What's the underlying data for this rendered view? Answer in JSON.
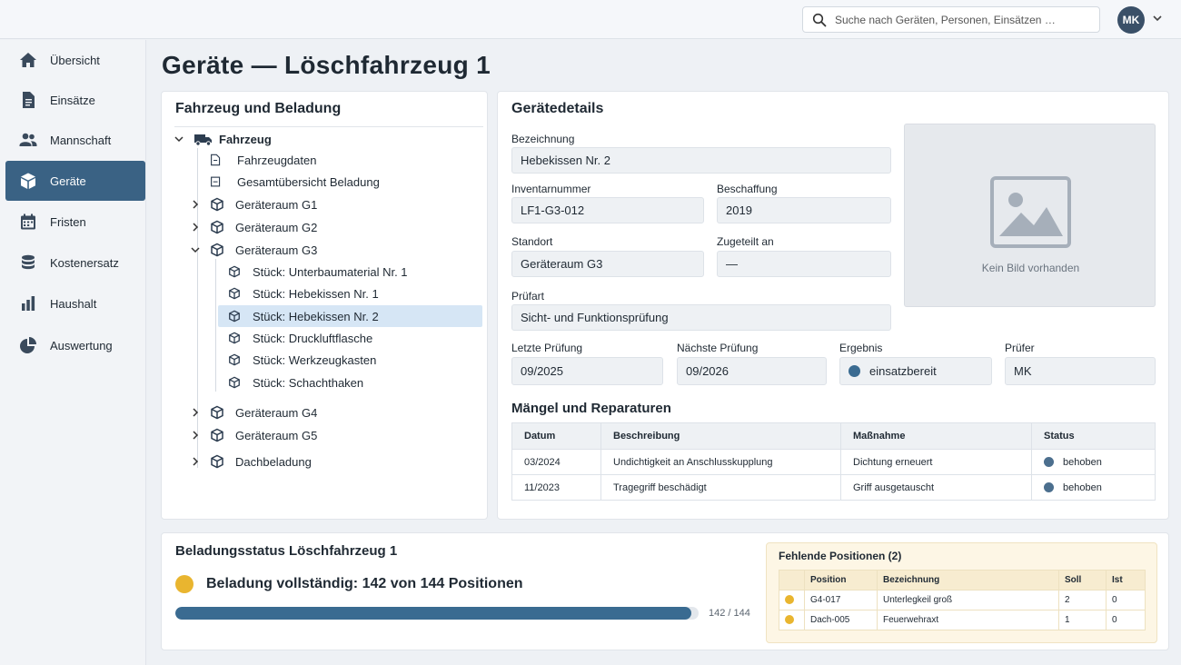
{
  "topbar": {
    "search_placeholder": "Suche nach Geräten, Personen, Einsätzen …",
    "user_initials": "MK"
  },
  "sidebar": {
    "items": [
      {
        "label": "Übersicht",
        "icon": "home-icon"
      },
      {
        "label": "Einsätze",
        "icon": "document-icon"
      },
      {
        "label": "Mannschaft",
        "icon": "people-icon"
      },
      {
        "label": "Geräte",
        "icon": "box-icon",
        "active": true
      },
      {
        "label": "Fristen",
        "icon": "calendar-icon"
      },
      {
        "label": "Kostenersatz",
        "icon": "coins-icon"
      },
      {
        "label": "Haushalt",
        "icon": "bar-chart-icon"
      },
      {
        "label": "Auswertung",
        "icon": "pie-chart-icon"
      }
    ]
  },
  "page": {
    "title": "Geräte — Löschfahrzeug 1"
  },
  "tree": {
    "title": "Fahrzeug und Beladung",
    "root": "Fahrzeug",
    "items": [
      "Fahrzeugdaten",
      "Gesamtübersicht Beladung",
      "Geräteraum G1",
      "Geräteraum G2",
      "Geräteraum G3",
      "Stück: Unterbaumaterial Nr. 1",
      "Stück: Hebekissen Nr. 1",
      "Stück: Hebekissen Nr. 2",
      "Stück: Druckluftflasche",
      "Stück: Werkzeugkasten",
      "Stück: Schachthaken",
      "Geräteraum G4",
      "Geräteraum G5",
      "Dachbeladung"
    ]
  },
  "details": {
    "title": "Gerätedetails",
    "bezeichnung_label": "Bezeichnung",
    "bezeichnung": "Hebekissen Nr. 2",
    "inventar_label": "Inventarnummer",
    "inventar": "LF1-G3-012",
    "beschaffung_label": "Beschaffung",
    "beschaffung": "2019",
    "standort_label": "Standort",
    "standort": "Geräteraum G3",
    "zugeteilt_label": "Zugeteilt an",
    "zugeteilt": "—",
    "pruefart_label": "Prüfart",
    "pruefart": "Sicht- und Funktionsprüfung",
    "letzte_label": "Letzte Prüfung",
    "letzte": "09/2025",
    "naechste_label": "Nächste Prüfung",
    "naechste": "09/2026",
    "ergebnis_label": "Ergebnis",
    "ergebnis": "einsatzbereit",
    "pruefer_label": "Prüfer",
    "pruefer": "MK",
    "image_placeholder": "Kein Bild vorhanden"
  },
  "defects": {
    "title": "Mängel und Reparaturen",
    "headers": [
      "Datum",
      "Beschreibung",
      "Maßnahme",
      "Status"
    ],
    "rows": [
      [
        "03/2024",
        "Undichtigkeit an Anschlusskupplung",
        "Dichtung erneuert",
        "behoben"
      ],
      [
        "11/2023",
        "Tragegriff beschädigt",
        "Griff ausgetauscht",
        "behoben"
      ]
    ]
  },
  "status": {
    "title": "Beladungsstatus Löschfahrzeug 1",
    "summary": "Beladung vollständig: 142 von 144 Positionen",
    "progress_label": "142 / 144",
    "progress_fraction": 0.986,
    "missing_title": "Fehlende Positionen (2)",
    "missing_headers": [
      "Position",
      "Bezeichnung",
      "Soll",
      "Ist"
    ],
    "missing_rows": [
      [
        "G4-017",
        "Unterlegkeil groß",
        "2",
        "0"
      ],
      [
        "Dach-005",
        "Feuerwehraxt",
        "1",
        "0"
      ]
    ]
  },
  "colors": {
    "accent": "#3a6284",
    "ok": "#3a6b91",
    "warning": "#e9b52f"
  }
}
